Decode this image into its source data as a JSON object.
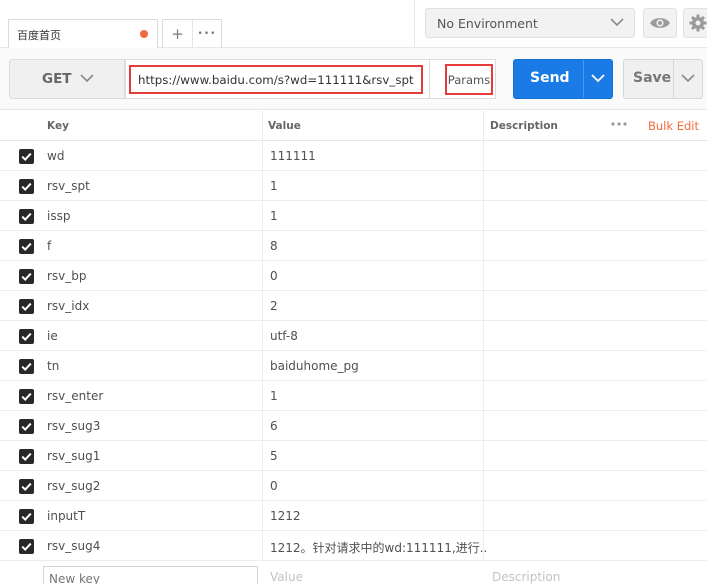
{
  "tab": {
    "title": "百度首页",
    "add_glyph": "+",
    "more_glyph": "•••"
  },
  "environment": {
    "selected": "No Environment"
  },
  "request": {
    "method": "GET",
    "url": "https://www.baidu.com/s?wd=111111&rsv_spt=...",
    "params_label": "Params",
    "send_label": "Send",
    "save_label": "Save"
  },
  "table": {
    "headers": {
      "key": "Key",
      "value": "Value",
      "description": "Description",
      "bulk_edit": "Bulk Edit"
    },
    "rows": [
      {
        "key": "wd",
        "value": "111111"
      },
      {
        "key": "rsv_spt",
        "value": "1"
      },
      {
        "key": "issp",
        "value": "1"
      },
      {
        "key": "f",
        "value": "8"
      },
      {
        "key": "rsv_bp",
        "value": "0"
      },
      {
        "key": "rsv_idx",
        "value": "2"
      },
      {
        "key": "ie",
        "value": "utf-8"
      },
      {
        "key": "tn",
        "value": "baiduhome_pg"
      },
      {
        "key": "rsv_enter",
        "value": "1"
      },
      {
        "key": "rsv_sug3",
        "value": "6"
      },
      {
        "key": "rsv_sug1",
        "value": "5"
      },
      {
        "key": "rsv_sug2",
        "value": "0"
      },
      {
        "key": "inputT",
        "value": "1212"
      },
      {
        "key": "rsv_sug4",
        "value": "1212。针对请求中的wd:111111,进行.."
      }
    ],
    "new_row": {
      "key_placeholder": "New key",
      "value_placeholder": "Value",
      "description_placeholder": "Description"
    }
  },
  "colors": {
    "accent_orange": "#f26b3a",
    "send_blue": "#1a7be6",
    "highlight_red": "#e53b3b"
  }
}
